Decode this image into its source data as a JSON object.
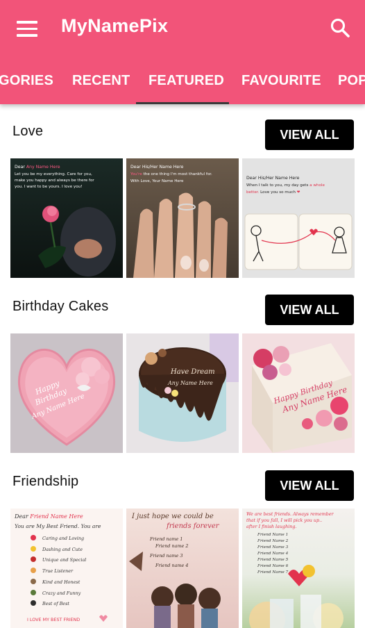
{
  "app": {
    "title": "MyNamePix"
  },
  "tabs": [
    "GORIES",
    "RECENT",
    "FEATURED",
    "FAVOURITE",
    "POP"
  ],
  "view_all_label": "VIEW ALL",
  "sections": [
    {
      "title": "Love",
      "cards": [
        {
          "line1_prefix": "Dear ",
          "line1_name": "Any Name Here",
          "lines": [
            "Let you be my everything. Care for you,",
            "make you happy and always be there for",
            "you. I want to be yours. I love you!"
          ]
        },
        {
          "line1": "Dear His/Her Name Here",
          "line2_pink": "You're",
          "line2_rest": " the one thing I'm most thankful for.",
          "line3": "With Love, Your Name Here"
        },
        {
          "line1": "Dear His/Her Name Here",
          "line2_a": "When I talk to you, my day gets ",
          "line2_b": "a whole",
          "line3_a": "better.",
          "line3_b": " Love you so much "
        }
      ]
    },
    {
      "title": "Birthday Cakes",
      "cards": [
        {
          "text": [
            "Happy",
            "Birthday",
            "Any Name Here"
          ]
        },
        {
          "text": [
            "Have Dream",
            "Any Name Here"
          ]
        },
        {
          "text": [
            "Happy Birthday",
            "Any Name Here"
          ]
        }
      ]
    },
    {
      "title": "Friendship",
      "cards": [
        {
          "header_prefix": "Dear ",
          "header_name": "Friend Name Here",
          "subtitle": "You are My Best Friend. You are",
          "items": [
            "Caring and Loving",
            "Dashing and Cute",
            "Unique and Special",
            "True Listener",
            "Kind and Honest",
            "Crazy and Funny",
            "Best of Best"
          ],
          "footer": "I LOVE MY BEST FRIEND"
        },
        {
          "title": [
            "I just hope we could be",
            "friends forever"
          ],
          "names": [
            "Friend name 1",
            "Friend name 2",
            "Friend name 3",
            "Friend name 4"
          ]
        },
        {
          "header": [
            "We are best friends. Always remember",
            "that if you fall, I will pick you up..",
            "after I finish laughing."
          ],
          "names": [
            "Friend Name 1",
            "Friend Name 2",
            "Friend Name 3",
            "Friend Name 4",
            "Friend Name 5",
            "Friend Name 6",
            "Friend Name 7"
          ]
        }
      ]
    }
  ],
  "colors": {
    "appbar": "#f25479",
    "accent_pink": "#e8356a",
    "button": "#000000"
  }
}
